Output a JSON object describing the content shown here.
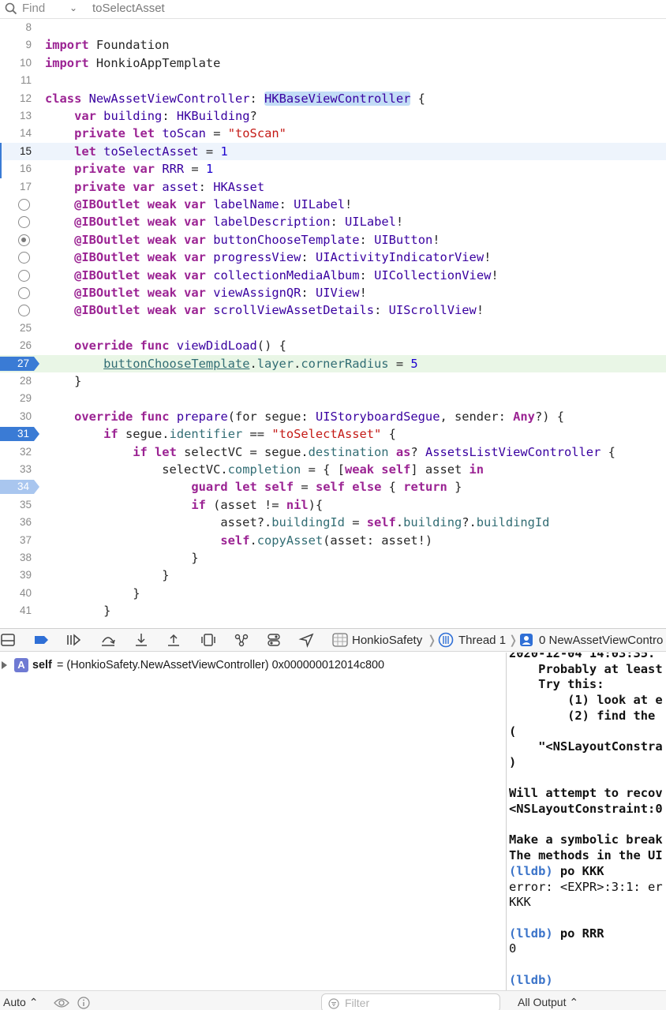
{
  "find_bar": {
    "label": "Find",
    "query": "toSelectAsset"
  },
  "editor": {
    "lines": [
      {
        "n": "8",
        "html": ""
      },
      {
        "n": "9",
        "html": "<span class='kw'>import</span> Foundation"
      },
      {
        "n": "10",
        "html": "<span class='kw'>import</span> HonkioAppTemplate"
      },
      {
        "n": "11",
        "html": ""
      },
      {
        "n": "12",
        "html": "<span class='kw'>class</span> <span class='ty'>NewAssetViewController</span>: <span class='hl ty'>HKBaseViewController</span> {"
      },
      {
        "n": "13",
        "html": "    <span class='kw'>var</span> <span class='ty'>building</span>: <span class='ty'>HKBuilding</span>?"
      },
      {
        "n": "14",
        "html": "    <span class='kw'>private</span> <span class='kw'>let</span> <span class='ty'>toScan</span> = <span class='st'>\"toScan\"</span>"
      },
      {
        "n": "15",
        "html": "    <span class='kw'>let</span> <span class='ty'>toSelectAsset</span> = <span class='nu'>1</span>"
      },
      {
        "n": "16",
        "html": "    <span class='kw'>private</span> <span class='kw'>var</span> <span class='ty'>RRR</span> = <span class='nu'>1</span>"
      },
      {
        "n": "17",
        "html": "    <span class='kw'>private</span> <span class='kw'>var</span> <span class='ty'>asset</span>: <span class='ty'>HKAsset</span>"
      },
      {
        "n": "",
        "html": "    <span class='kw'>@IBOutlet</span> <span class='kw'>weak</span> <span class='kw'>var</span> <span class='ty'>labelName</span>: <span class='ty'>UILabel</span>!"
      },
      {
        "n": "",
        "html": "    <span class='kw'>@IBOutlet</span> <span class='kw'>weak</span> <span class='kw'>var</span> <span class='ty'>labelDescription</span>: <span class='ty'>UILabel</span>!"
      },
      {
        "n": "",
        "html": "    <span class='kw'>@IBOutlet</span> <span class='kw'>weak</span> <span class='kw'>var</span> <span class='ty'>buttonChooseTemplate</span>: <span class='ty'>UIButton</span>!"
      },
      {
        "n": "",
        "html": "    <span class='kw'>@IBOutlet</span> <span class='kw'>weak</span> <span class='kw'>var</span> <span class='ty'>progressView</span>: <span class='ty'>UIActivityIndicatorView</span>!"
      },
      {
        "n": "",
        "html": "    <span class='kw'>@IBOutlet</span> <span class='kw'>weak</span> <span class='kw'>var</span> <span class='ty'>collectionMediaAlbum</span>: <span class='ty'>UICollectionView</span>!"
      },
      {
        "n": "",
        "html": "    <span class='kw'>@IBOutlet</span> <span class='kw'>weak</span> <span class='kw'>var</span> <span class='ty'>viewAssignQR</span>: <span class='ty'>UIView</span>!"
      },
      {
        "n": "",
        "html": "    <span class='kw'>@IBOutlet</span> <span class='kw'>weak</span> <span class='kw'>var</span> <span class='ty'>scrollViewAssetDetails</span>: <span class='ty'>UIScrollView</span>!"
      },
      {
        "n": "25",
        "html": ""
      },
      {
        "n": "26",
        "html": "    <span class='kw'>override</span> <span class='kw'>func</span> <span class='ty'>viewDidLoad</span>() {"
      },
      {
        "n": "27",
        "html": "        <span class='ul mem'>buttonChooseTemplate</span>.<span class='mem'>layer</span>.<span class='mem'>cornerRadius</span> = <span class='nu'>5</span>"
      },
      {
        "n": "28",
        "html": "    }"
      },
      {
        "n": "29",
        "html": ""
      },
      {
        "n": "30",
        "html": "    <span class='kw'>override</span> <span class='kw'>func</span> <span class='ty'>prepare</span>(for segue: <span class='ty'>UIStoryboardSegue</span>, sender: <span class='kw'>Any</span>?) {"
      },
      {
        "n": "31",
        "html": "        <span class='kw'>if</span> segue.<span class='mem'>identifier</span> == <span class='st'>\"toSelectAsset\"</span> {"
      },
      {
        "n": "32",
        "html": "            <span class='kw'>if</span> <span class='kw'>let</span> selectVC = segue.<span class='mem'>destination</span> <span class='kw'>as</span>? <span class='ty'>AssetsListViewController</span> {"
      },
      {
        "n": "33",
        "html": "                selectVC.<span class='mem'>completion</span> = { [<span class='kw'>weak</span> <span class='kw'>self</span>] asset <span class='kw'>in</span>"
      },
      {
        "n": "34",
        "html": "                    <span class='kw'>guard</span> <span class='kw'>let</span> <span class='kw'>self</span> = <span class='kw'>self</span> <span class='kw'>else</span> { <span class='kw'>return</span> }"
      },
      {
        "n": "35",
        "html": "                    <span class='kw'>if</span> (asset != <span class='kw'>nil</span>){"
      },
      {
        "n": "36",
        "html": "                        asset?.<span class='mem'>buildingId</span> = <span class='kw'>self</span>.<span class='mem'>building</span>?.<span class='mem'>buildingId</span>"
      },
      {
        "n": "37",
        "html": "                        <span class='kw'>self</span>.<span class='mem'>copyAsset</span>(asset: asset!)"
      },
      {
        "n": "38",
        "html": "                    }"
      },
      {
        "n": "39",
        "html": "                }"
      },
      {
        "n": "40",
        "html": "            }"
      },
      {
        "n": "41",
        "html": "        }"
      }
    ]
  },
  "debug_toolbar": {
    "scheme": "HonkioSafety",
    "thread": "Thread 1",
    "frame": "0 NewAssetViewContro"
  },
  "variables": {
    "badge": "A",
    "name": "self",
    "value": "= (HonkioSafety.NewAssetViewController) 0x000000012014c800"
  },
  "console": {
    "lines": [
      {
        "t": "2020-12-04 14:03:35.",
        "cls": ""
      },
      {
        "t": "    Probably at least",
        "cls": ""
      },
      {
        "t": "    Try this:",
        "cls": ""
      },
      {
        "t": "        (1) look at e",
        "cls": ""
      },
      {
        "t": "        (2) find the",
        "cls": ""
      },
      {
        "t": "(",
        "cls": ""
      },
      {
        "t": "    \"<NSLayoutConstra",
        "cls": ""
      },
      {
        "t": ")",
        "cls": ""
      },
      {
        "t": "",
        "cls": ""
      },
      {
        "t": "Will attempt to recov",
        "cls": ""
      },
      {
        "t": "<NSLayoutConstraint:0",
        "cls": ""
      },
      {
        "t": "",
        "cls": ""
      },
      {
        "t": "Make a symbolic break",
        "cls": ""
      },
      {
        "t": "The methods in the UI",
        "cls": ""
      },
      {
        "t": "(lldb) po KKK",
        "cls": "lldb"
      },
      {
        "t": "error: <EXPR>:3:1: er",
        "cls": "plain"
      },
      {
        "t": "KKK",
        "cls": "plain"
      },
      {
        "t": "",
        "cls": ""
      },
      {
        "t": "(lldb) po RRR",
        "cls": "lldb"
      },
      {
        "t": "0",
        "cls": "plain"
      },
      {
        "t": "",
        "cls": ""
      },
      {
        "t": "(lldb)",
        "cls": "lldb"
      }
    ]
  },
  "bottom_bar": {
    "auto_label": "Auto ⌃",
    "filter_placeholder": "Filter",
    "output_label": "All Output ⌃"
  },
  "colors": {
    "keyword": "#9b2393",
    "type": "#3900a0",
    "string": "#c41a16",
    "number": "#1c00cf",
    "breakpoint_active": "#3a7bd5",
    "breakpoint_disabled": "#a9c6ef",
    "current_line": "#eef4fc",
    "execution_line": "#e9f6e6",
    "lldb_prompt": "#3a73c9"
  }
}
